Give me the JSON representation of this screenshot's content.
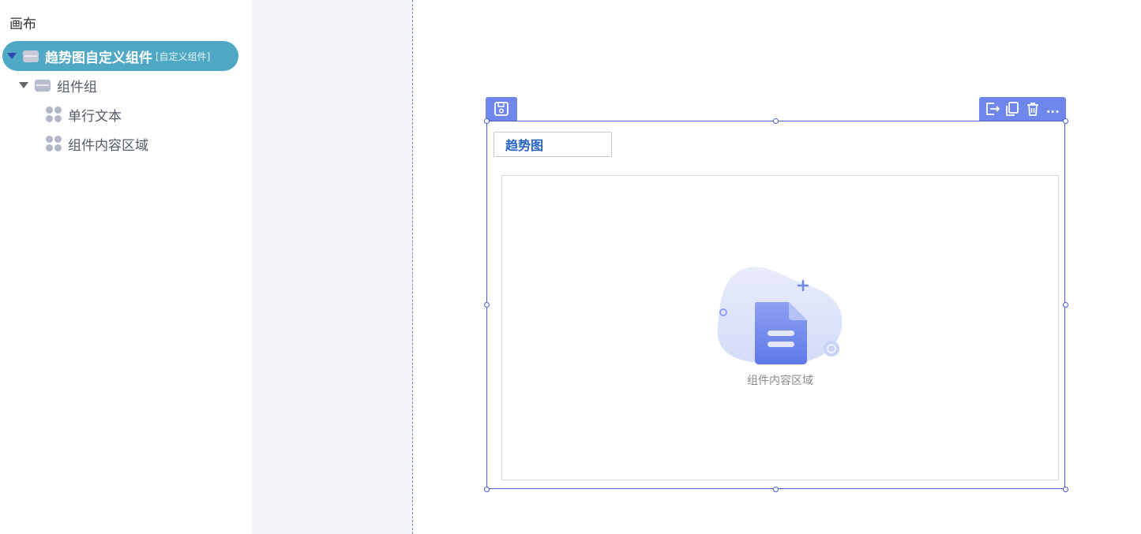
{
  "tree": {
    "title": "画布",
    "root": {
      "label": "趋势图自定义组件",
      "tag": "[自定义组件]"
    },
    "group": {
      "label": "组件组"
    },
    "items": [
      {
        "label": "单行文本"
      },
      {
        "label": "组件内容区域"
      }
    ]
  },
  "component": {
    "title_value": "趋势图",
    "content_label": "组件内容区域",
    "toolbar_more": "..."
  },
  "colors": {
    "selected_row": "#4fa8c4",
    "frame_border": "#4a5fd0",
    "toolbar_bg": "#6f86ea",
    "title_text": "#2462c4",
    "canvas_gray": "#f4f5f8"
  },
  "icons": {
    "save": "save-icon",
    "export": "export-icon",
    "copy": "copy-icon",
    "delete": "trash-icon",
    "more": "more-icon",
    "folder": "folder-icon",
    "widget": "widget-icon",
    "caret": "caret-down-icon",
    "empty": "document-placeholder-icon"
  }
}
